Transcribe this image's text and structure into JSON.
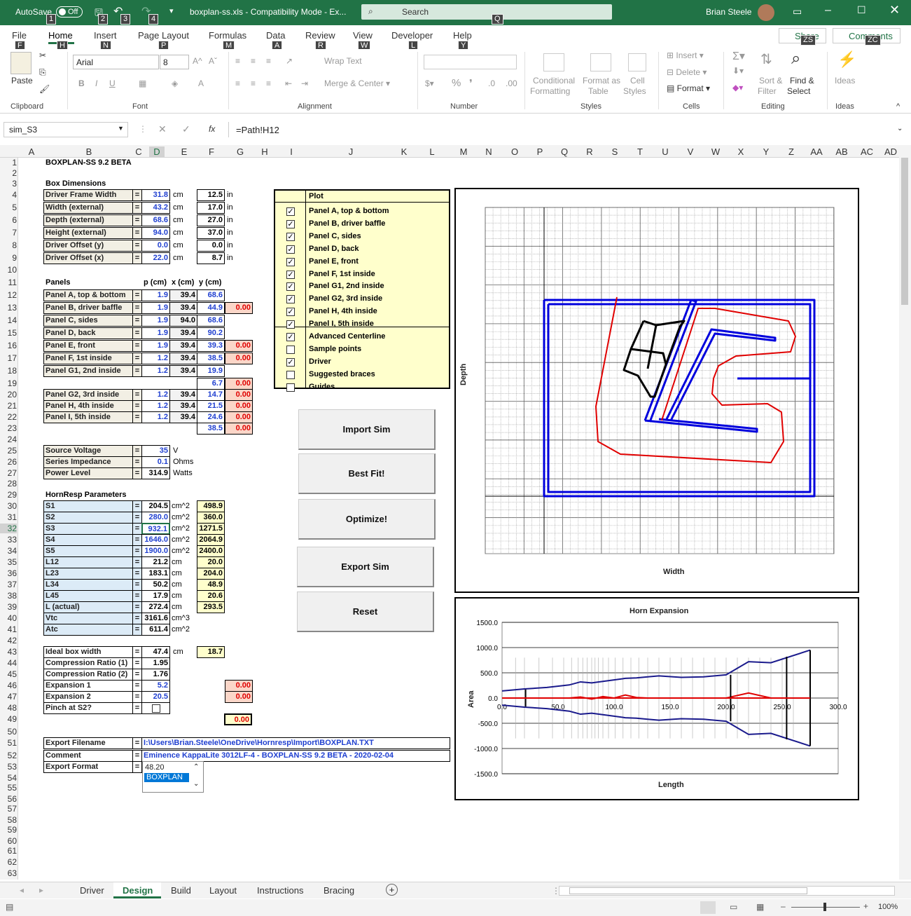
{
  "titlebar": {
    "autosave": "AutoSave",
    "toggle": "Off",
    "filename": "boxplan-ss.xls  -  Compatibility Mode  -  Ex...",
    "search": "Search",
    "user": "Brian Steele",
    "keytips": [
      "1",
      "2",
      "3",
      "4",
      "Q"
    ]
  },
  "tabs": [
    {
      "label": "File",
      "key": "F"
    },
    {
      "label": "Home",
      "key": "H"
    },
    {
      "label": "Insert",
      "key": "N"
    },
    {
      "label": "Page Layout",
      "key": "P"
    },
    {
      "label": "Formulas",
      "key": "M"
    },
    {
      "label": "Data",
      "key": "A"
    },
    {
      "label": "Review",
      "key": "R"
    },
    {
      "label": "View",
      "key": "W"
    },
    {
      "label": "Developer",
      "key": "L"
    },
    {
      "label": "Help",
      "key": "Y"
    }
  ],
  "share": "Share",
  "share_key": "ZS",
  "comments": "Comments",
  "comments_key": "ZC",
  "ribbon": {
    "paste": "Paste",
    "font_name": "Arial",
    "font_size": "8",
    "wrap": "Wrap Text",
    "merge": "Merge & Center",
    "cond": "Conditional",
    "cond2": "Formatting",
    "fmt_table": "Format as",
    "fmt_table2": "Table",
    "cell_styles": "Cell",
    "cell_styles2": "Styles",
    "insert": "Insert",
    "delete": "Delete",
    "format": "Format",
    "sort": "Sort &",
    "sort2": "Filter",
    "find": "Find &",
    "find2": "Select",
    "ideas": "Ideas",
    "groups": [
      "Clipboard",
      "Font",
      "Alignment",
      "Number",
      "Styles",
      "Cells",
      "Editing",
      "Ideas"
    ]
  },
  "formula": {
    "namebox": "sim_S3",
    "fx": "fx",
    "value": "=Path!H12"
  },
  "columns": [
    "A",
    "B",
    "C",
    "D",
    "E",
    "F",
    "G",
    "H",
    "I",
    "J",
    "K",
    "L",
    "M",
    "N",
    "O",
    "P",
    "Q",
    "R",
    "S",
    "T",
    "U",
    "V",
    "W",
    "X",
    "Y",
    "Z",
    "AA",
    "AB",
    "AC",
    "AD"
  ],
  "rows": [
    "1",
    "2",
    "3",
    "4",
    "5",
    "6",
    "7",
    "8",
    "9",
    "10",
    "11",
    "12",
    "13",
    "14",
    "15",
    "16",
    "17",
    "18",
    "19",
    "20",
    "21",
    "22",
    "23",
    "24",
    "25",
    "26",
    "27",
    "28",
    "29",
    "30",
    "31",
    "32",
    "33",
    "34",
    "35",
    "36",
    "37",
    "38",
    "39",
    "40",
    "41",
    "42",
    "43",
    "44",
    "45",
    "46",
    "47",
    "48",
    "49",
    "50",
    "51",
    "52",
    "53",
    "54",
    "55",
    "56",
    "57",
    "58",
    "59",
    "60",
    "61",
    "62",
    "63"
  ],
  "sheet": {
    "title": "BOXPLAN-SS 9.2 BETA",
    "box_dimensions": "Box Dimensions",
    "dims": [
      {
        "label": "Driver Frame Width",
        "cm": "31.8",
        "in": "12.5"
      },
      {
        "label": "Width (external)",
        "cm": "43.2",
        "in": "17.0"
      },
      {
        "label": "Depth (external)",
        "cm": "68.6",
        "in": "27.0"
      },
      {
        "label": "Height (external)",
        "cm": "94.0",
        "in": "37.0"
      },
      {
        "label": "Driver Offset (y)",
        "cm": "0.0",
        "in": "0.0"
      },
      {
        "label": "Driver Offset (x)",
        "cm": "22.0",
        "in": "8.7"
      }
    ],
    "panels_hdr": "Panels",
    "p_hdr": "p (cm)",
    "x_hdr": "x (cm)",
    "y_hdr": "y (cm)",
    "panels": [
      {
        "label": "Panel A, top & bottom",
        "p": "1.9",
        "x": "39.4",
        "y": "68.6",
        "g": ""
      },
      {
        "label": "Panel B, driver baffle",
        "p": "1.9",
        "x": "39.4",
        "y": "44.9",
        "g": "0.00"
      },
      {
        "label": "Panel C, sides",
        "p": "1.9",
        "x": "94.0",
        "y": "68.6",
        "g": ""
      },
      {
        "label": "Panel D, back",
        "p": "1.9",
        "x": "39.4",
        "y": "90.2",
        "g": ""
      },
      {
        "label": "Panel E, front",
        "p": "1.9",
        "x": "39.4",
        "y": "39.3",
        "g": "0.00"
      },
      {
        "label": "Panel F, 1st inside",
        "p": "1.2",
        "x": "39.4",
        "y": "38.5",
        "g": "0.00"
      },
      {
        "label": "Panel G1, 2nd inside",
        "p": "1.2",
        "x": "39.4",
        "y": "19.9",
        "g": ""
      }
    ],
    "row19": {
      "y": "6.7",
      "g": "0.00"
    },
    "panels2": [
      {
        "label": "Panel G2, 3rd inside",
        "p": "1.2",
        "x": "39.4",
        "y": "14.7",
        "g": "0.00"
      },
      {
        "label": "Panel H, 4th inside",
        "p": "1.2",
        "x": "39.4",
        "y": "21.5",
        "g": "0.00"
      },
      {
        "label": "Panel I, 5th inside",
        "p": "1.2",
        "x": "39.4",
        "y": "24.6",
        "g": "0.00"
      }
    ],
    "row23": {
      "y": "38.5",
      "g": "0.00"
    },
    "power": [
      {
        "label": "Source Voltage",
        "v": "35",
        "u": "V"
      },
      {
        "label": "Series Impedance",
        "v": "0.1",
        "u": "Ohms"
      },
      {
        "label": "Power Level",
        "v": "314.9",
        "u": "Watts"
      }
    ],
    "hornresp_hdr": "HornResp Parameters",
    "hornresp": [
      {
        "label": "S1",
        "v": "204.5",
        "u": "cm^2",
        "y": "498.9",
        "c": "bk"
      },
      {
        "label": "S2",
        "v": "280.0",
        "u": "cm^2",
        "y": "360.0",
        "c": "bl"
      },
      {
        "label": "S3",
        "v": "932.1",
        "u": "cm^2",
        "y": "1271.5",
        "c": "bl"
      },
      {
        "label": "S4",
        "v": "1646.0",
        "u": "cm^2",
        "y": "2064.9",
        "c": "bl"
      },
      {
        "label": "S5",
        "v": "1900.0",
        "u": "cm^2",
        "y": "2400.0",
        "c": "bl"
      },
      {
        "label": "L12",
        "v": "21.2",
        "u": "cm",
        "y": "20.0",
        "c": "bk"
      },
      {
        "label": "L23",
        "v": "183.1",
        "u": "cm",
        "y": "204.0",
        "c": "bk"
      },
      {
        "label": "L34",
        "v": "50.2",
        "u": "cm",
        "y": "48.9",
        "c": "bk"
      },
      {
        "label": "L45",
        "v": "17.9",
        "u": "cm",
        "y": "20.6",
        "c": "bk"
      },
      {
        "label": "L (actual)",
        "v": "272.4",
        "u": "cm",
        "y": "293.5",
        "c": "bk"
      },
      {
        "label": "Vtc",
        "v": "3161.6",
        "u": "cm^3",
        "y": "",
        "c": "bk"
      },
      {
        "label": "Atc",
        "v": "611.4",
        "u": "cm^2",
        "y": "",
        "c": "bk"
      }
    ],
    "misc": [
      {
        "label": "Ideal box width",
        "v": "47.4",
        "u": "cm",
        "y": "18.7",
        "g": "",
        "c": "bk"
      },
      {
        "label": "Compression Ratio (1)",
        "v": "1.95",
        "u": "",
        "y": "",
        "g": "",
        "c": "bk"
      },
      {
        "label": "Compression Ratio (2)",
        "v": "1.76",
        "u": "",
        "y": "",
        "g": "",
        "c": "bk"
      },
      {
        "label": "Expansion 1",
        "v": "5.2",
        "u": "",
        "y": "",
        "g": "0.00",
        "c": "bl"
      },
      {
        "label": "Expansion 2",
        "v": "20.5",
        "u": "",
        "y": "",
        "g": "0.00",
        "c": "bl"
      },
      {
        "label": "Pinch at S2?",
        "v": "",
        "u": "",
        "y": "",
        "g": "",
        "c": "bk"
      }
    ],
    "row49": "0.00",
    "export": [
      {
        "label": "Export Filename",
        "v": "I:\\Users\\Brian.Steele\\OneDrive\\Hornresp\\Import\\BOXPLAN.TXT"
      },
      {
        "label": "Comment",
        "v": "Eminence KappaLite 3012LF-4 - BOXPLAN-SS 9.2 BETA - 2020-02-04"
      },
      {
        "label": "Export Format",
        "v": ""
      }
    ],
    "dropdown": [
      "48.20",
      "BOXPLAN"
    ]
  },
  "plot_panel": {
    "header": "Plot",
    "items": [
      {
        "label": "Panel A, top & bottom",
        "checked": "✓"
      },
      {
        "label": "Panel B, driver baffle",
        "checked": "✓"
      },
      {
        "label": "Panel C, sides",
        "checked": "✓"
      },
      {
        "label": "Panel D, back",
        "checked": "✓"
      },
      {
        "label": "Panel E, front",
        "checked": "✓"
      },
      {
        "label": "Panel F, 1st inside",
        "checked": "✓"
      },
      {
        "label": "Panel G1, 2nd inside",
        "checked": "✓"
      },
      {
        "label": "Panel G2, 3rd inside",
        "checked": "✓"
      },
      {
        "label": "Panel H, 4th inside",
        "checked": "✓"
      },
      {
        "label": "Panel I, 5th inside",
        "checked": "✓"
      },
      {
        "label": "Advanced Centerline",
        "checked": "✓"
      },
      {
        "label": "Sample points",
        "checked": ""
      },
      {
        "label": "Driver",
        "checked": "✓"
      },
      {
        "label": "Suggested braces",
        "checked": ""
      },
      {
        "label": "Guides",
        "checked": ""
      }
    ]
  },
  "buttons": [
    "Import Sim",
    "Best Fit!",
    "Optimize!",
    "Export Sim",
    "Reset"
  ],
  "chart_data": [
    {
      "type": "line",
      "title": "",
      "xlabel": "Width",
      "ylabel": "Depth",
      "grid": true
    },
    {
      "type": "line",
      "title": "Horn Expansion",
      "xlabel": "Length",
      "ylabel": "Area",
      "xlim": [
        0,
        300
      ],
      "ylim": [
        -1500,
        1500
      ],
      "xticks": [
        "0.0",
        "50.0",
        "100.0",
        "150.0",
        "200.0",
        "250.0",
        "300.0"
      ],
      "yticks": [
        "1500.0",
        "1000.0",
        "500.0",
        "0.0",
        "-500.0",
        "-1000.0",
        "-1500.0"
      ],
      "series": [
        {
          "color": "#1a1a8c",
          "x": [
            0,
            20,
            40,
            60,
            70,
            80,
            90,
            100,
            110,
            120,
            130,
            140,
            160,
            180,
            200,
            220,
            240,
            275
          ],
          "y": [
            140,
            180,
            210,
            260,
            320,
            300,
            330,
            360,
            390,
            400,
            420,
            440,
            410,
            420,
            460,
            720,
            700,
            950
          ]
        },
        {
          "color": "#e00000",
          "x": [
            0,
            20,
            40,
            60,
            70,
            80,
            90,
            100,
            110,
            120,
            130,
            140,
            160,
            180,
            200,
            220,
            240,
            275
          ],
          "y": [
            0,
            0,
            0,
            0,
            20,
            -20,
            30,
            0,
            60,
            10,
            0,
            0,
            0,
            0,
            0,
            100,
            0,
            0
          ]
        }
      ]
    }
  ],
  "sheet_tabs": [
    "Driver",
    "Design",
    "Build",
    "Layout",
    "Instructions",
    "Bracing"
  ],
  "zoom": "100%"
}
